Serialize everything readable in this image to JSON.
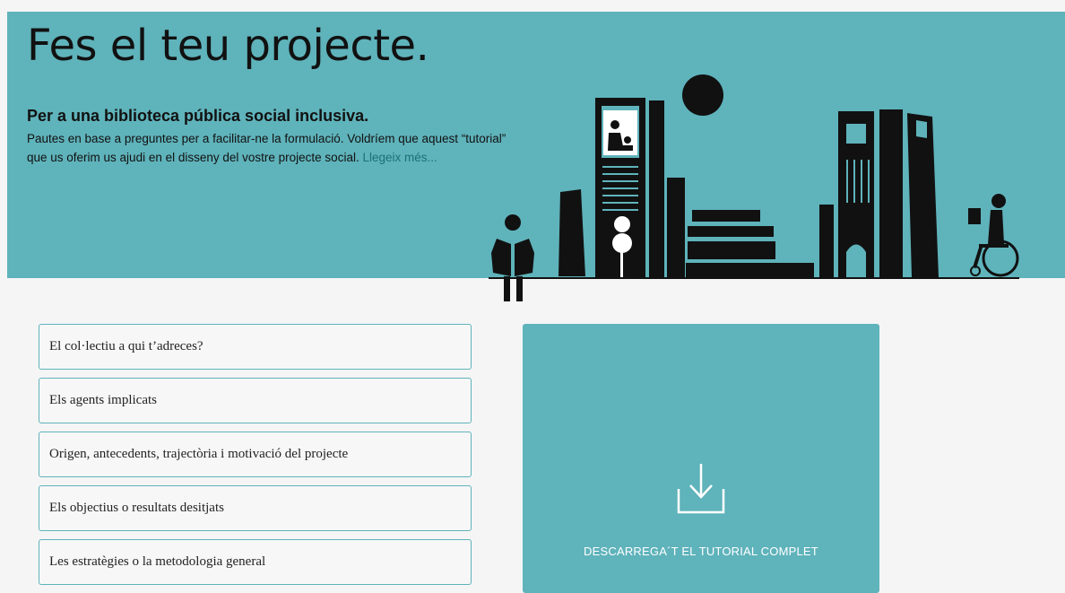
{
  "hero": {
    "title": "Fes el teu projecte.",
    "subtitle": "Per a una biblioteca pública social inclusiva.",
    "description": "Pautes en base a preguntes per a facilitar-ne la formulació. Voldríem que aquest “tutorial” que us oferim us ajudi en el disseny del vostre projecte social.",
    "read_more": "Llegeix més..."
  },
  "accordion": {
    "items": [
      {
        "label": "El col·lectiu a qui t’adreces?"
      },
      {
        "label": "Els agents implicats"
      },
      {
        "label": "Origen, antecedents, trajectòria i motivació del projecte"
      },
      {
        "label": "Els objectius o resultats desitjats"
      },
      {
        "label": "Les estratègies o la metodologia general"
      }
    ]
  },
  "download": {
    "label": "DESCARREGA´T EL TUTORIAL COMPLET",
    "icon": "download-icon"
  },
  "colors": {
    "accent": "#5fb3bb",
    "background": "#f5f5f5",
    "text": "#111111",
    "link": "#1e6f77"
  }
}
